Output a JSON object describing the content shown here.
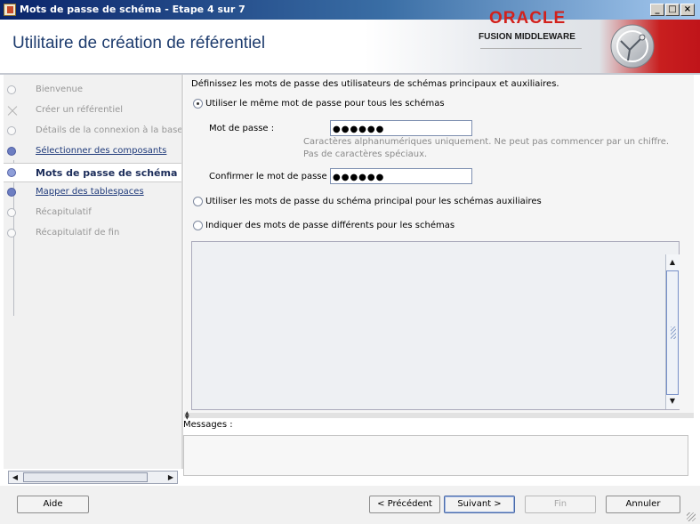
{
  "window": {
    "title": "Mots de passe de schéma - Etape 4 sur 7",
    "minimize": "_",
    "maximize": "□",
    "close": "×"
  },
  "header": {
    "title": "Utilitaire de création de référentiel",
    "brand": "ORACLE",
    "product": "FUSION MIDDLEWARE"
  },
  "nav": {
    "items": [
      {
        "label": "Bienvenue",
        "state": "done"
      },
      {
        "label": "Créer un référentiel",
        "state": "done"
      },
      {
        "label": "Détails de la connexion à la base de",
        "state": "done"
      },
      {
        "label": "Sélectionner des composants",
        "state": "link"
      },
      {
        "label": "Mots de passe de schéma",
        "state": "active"
      },
      {
        "label": "Mapper des tablespaces",
        "state": "link"
      },
      {
        "label": "Récapitulatif",
        "state": "pending"
      },
      {
        "label": "Récapitulatif de fin",
        "state": "pending"
      }
    ]
  },
  "main": {
    "intro": "Définissez les mots de passe des utilisateurs de schémas principaux et auxiliaires.",
    "option_same_label": "Utiliser le même mot de passe pour tous les schémas",
    "password_label": "Mot de passe :",
    "password_value": "●●●●●●",
    "hint_line1": "Caractères alphanumériques uniquement. Ne peut pas commencer par un chiffre.",
    "hint_line2": "Pas de caractères spéciaux.",
    "confirm_label": "Confirmer le mot de passe :",
    "confirm_value": "●●●●●●",
    "option_main_label": "Utiliser les mots de passe du schéma principal pour les schémas auxiliaires",
    "option_different_label": "Indiquer des mots de passe différents pour les schémas",
    "selected_option": "same"
  },
  "messages": {
    "label": "Messages :"
  },
  "buttons": {
    "help": "Aide",
    "previous": "< Précédent",
    "next": "Suivant >",
    "finish": "Fin",
    "cancel": "Annuler"
  }
}
